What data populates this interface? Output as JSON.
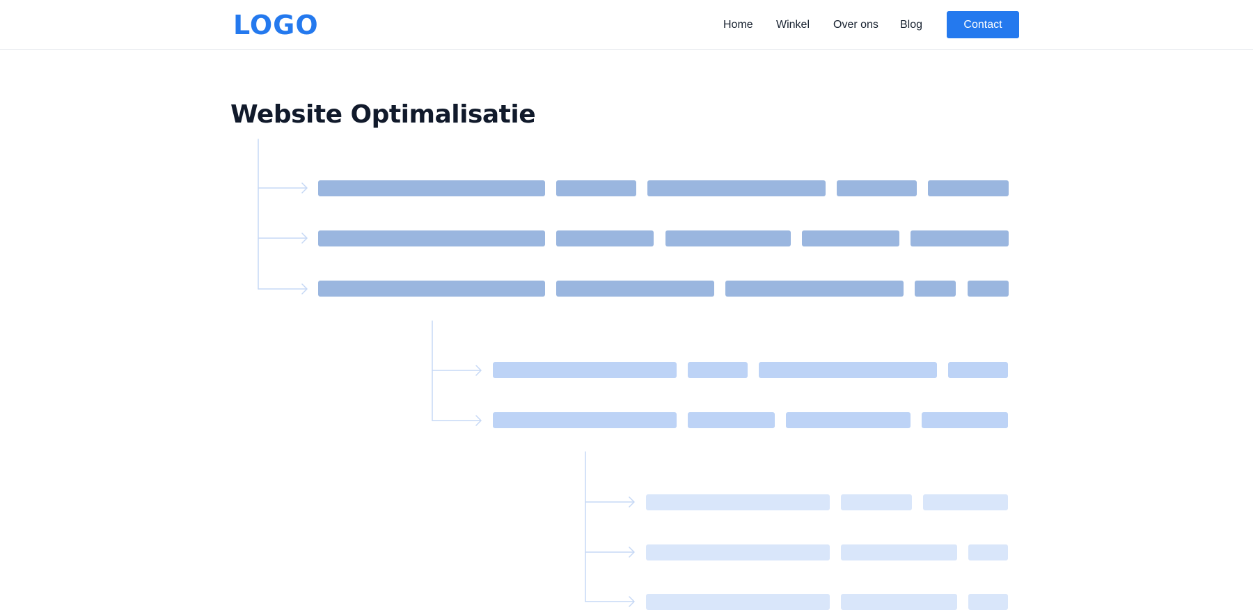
{
  "header": {
    "logo": "LOGO",
    "nav": [
      "Home",
      "Winkel",
      "Over ons",
      "Blog"
    ],
    "cta_label": "Contact"
  },
  "main": {
    "title": "Website Optimalisatie"
  },
  "colors": {
    "accent": "#2479ee",
    "title": "#111a2b",
    "level_1": "#9ab6df",
    "level_2": "#bdd3f6",
    "level_3": "#d9e6fa",
    "connector": "#c6d8f5"
  }
}
